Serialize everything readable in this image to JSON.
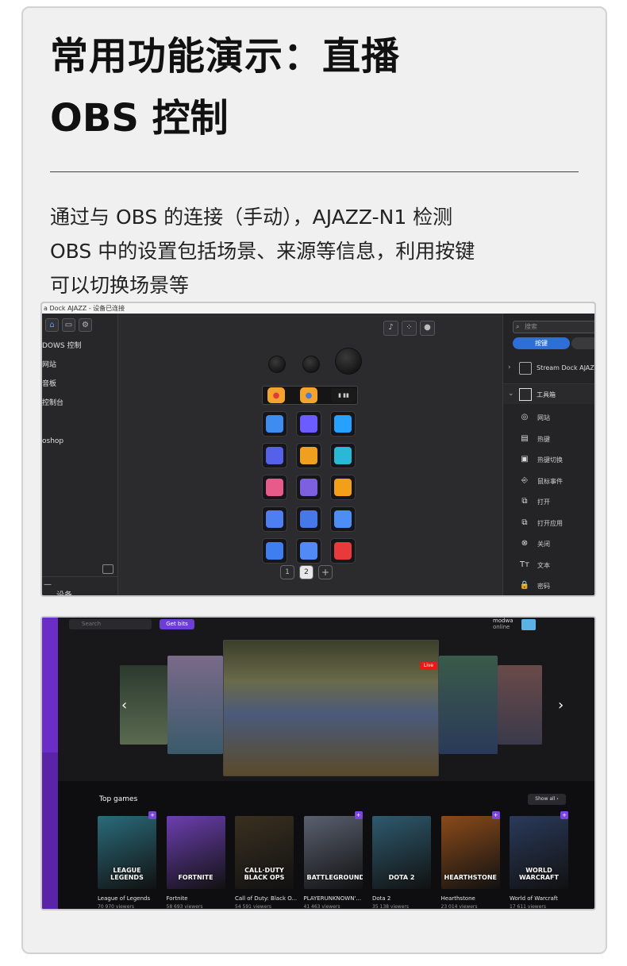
{
  "heading": {
    "line1": "常用功能演示：直播",
    "line2": "OBS 控制"
  },
  "description": {
    "line1": "通过与 OBS 的连接（手动），AJAZZ-N1 检测",
    "line2": "OBS 中的设置包括场景、来源等信息，利用按键",
    "line3": "可以切换场景等"
  },
  "streamdock": {
    "window_title": "a Dock AJAZZ - 设备已连接",
    "left_items": [
      "DOWS 控制",
      "网站",
      "音板",
      "控制台",
      "",
      "oshop"
    ],
    "bottom_dash": "—",
    "bottom_label": "设备",
    "pages": [
      "1",
      "2",
      "+"
    ],
    "search_placeholder": "搜索",
    "tab_active": "按键",
    "plugins": [
      {
        "label": "Stream Dock AJAZZ",
        "chevron": "›"
      },
      {
        "label": "工具箱",
        "chevron": "⌄"
      }
    ],
    "tools": [
      {
        "icon": "◎",
        "label": "网站"
      },
      {
        "icon": "▤",
        "label": "热键"
      },
      {
        "icon": "▣",
        "label": "热键切换"
      },
      {
        "icon": "⎆",
        "label": "鼠标事件"
      },
      {
        "icon": "⧉",
        "label": "打开"
      },
      {
        "icon": "⧉",
        "label": "打开应用"
      },
      {
        "icon": "⊗",
        "label": "关闭"
      },
      {
        "icon": "Tт",
        "label": "文本"
      },
      {
        "icon": "🔒",
        "label": "密码"
      }
    ],
    "key_colors": [
      "#3f8cf0",
      "#6a5cff",
      "#27a1ff",
      "#5561e8",
      "#f0a020",
      "#29b9d6",
      "#e85a8a",
      "#7b61e0",
      "#f29f1a",
      "#4e7ff2",
      "#4678e8",
      "#4d8ef5",
      "#3f7ef0",
      "#5189f5",
      "#e83a3a"
    ]
  },
  "twitch": {
    "search_placeholder": "Search",
    "get_bits": "Get bits",
    "user_name": "modwa",
    "user_status": "online",
    "live_badge": "Live",
    "top_games_label": "Top games",
    "show_all": "Show all  ›",
    "games": [
      {
        "title": "League of Legends",
        "viewers": "70 970 viewers",
        "art": "LEAGUE LEGENDS",
        "color": "#2a6b7a"
      },
      {
        "title": "Fortnite",
        "viewers": "58 693 viewers",
        "art": "FORTNITE",
        "color": "#6b3fb0"
      },
      {
        "title": "Call of Duty: Black O...",
        "viewers": "54 591 viewers",
        "art": "CALL·DUTY BLACK OPS",
        "color": "#3a3020"
      },
      {
        "title": "PLAYERUNKNOWN'...",
        "viewers": "41 463 viewers",
        "art": "BATTLEGROUNDS",
        "color": "#5a6070"
      },
      {
        "title": "Dota 2",
        "viewers": "35 138 viewers",
        "art": "DOTA 2",
        "color": "#2e5a6e"
      },
      {
        "title": "Hearthstone",
        "viewers": "23 014 viewers",
        "art": "HEARTHSTONE",
        "color": "#8a4a1a"
      },
      {
        "title": "World of Warcraft",
        "viewers": "17 611 viewers",
        "art": "WORLD WARCRAFT",
        "color": "#2a3a5a"
      }
    ]
  }
}
